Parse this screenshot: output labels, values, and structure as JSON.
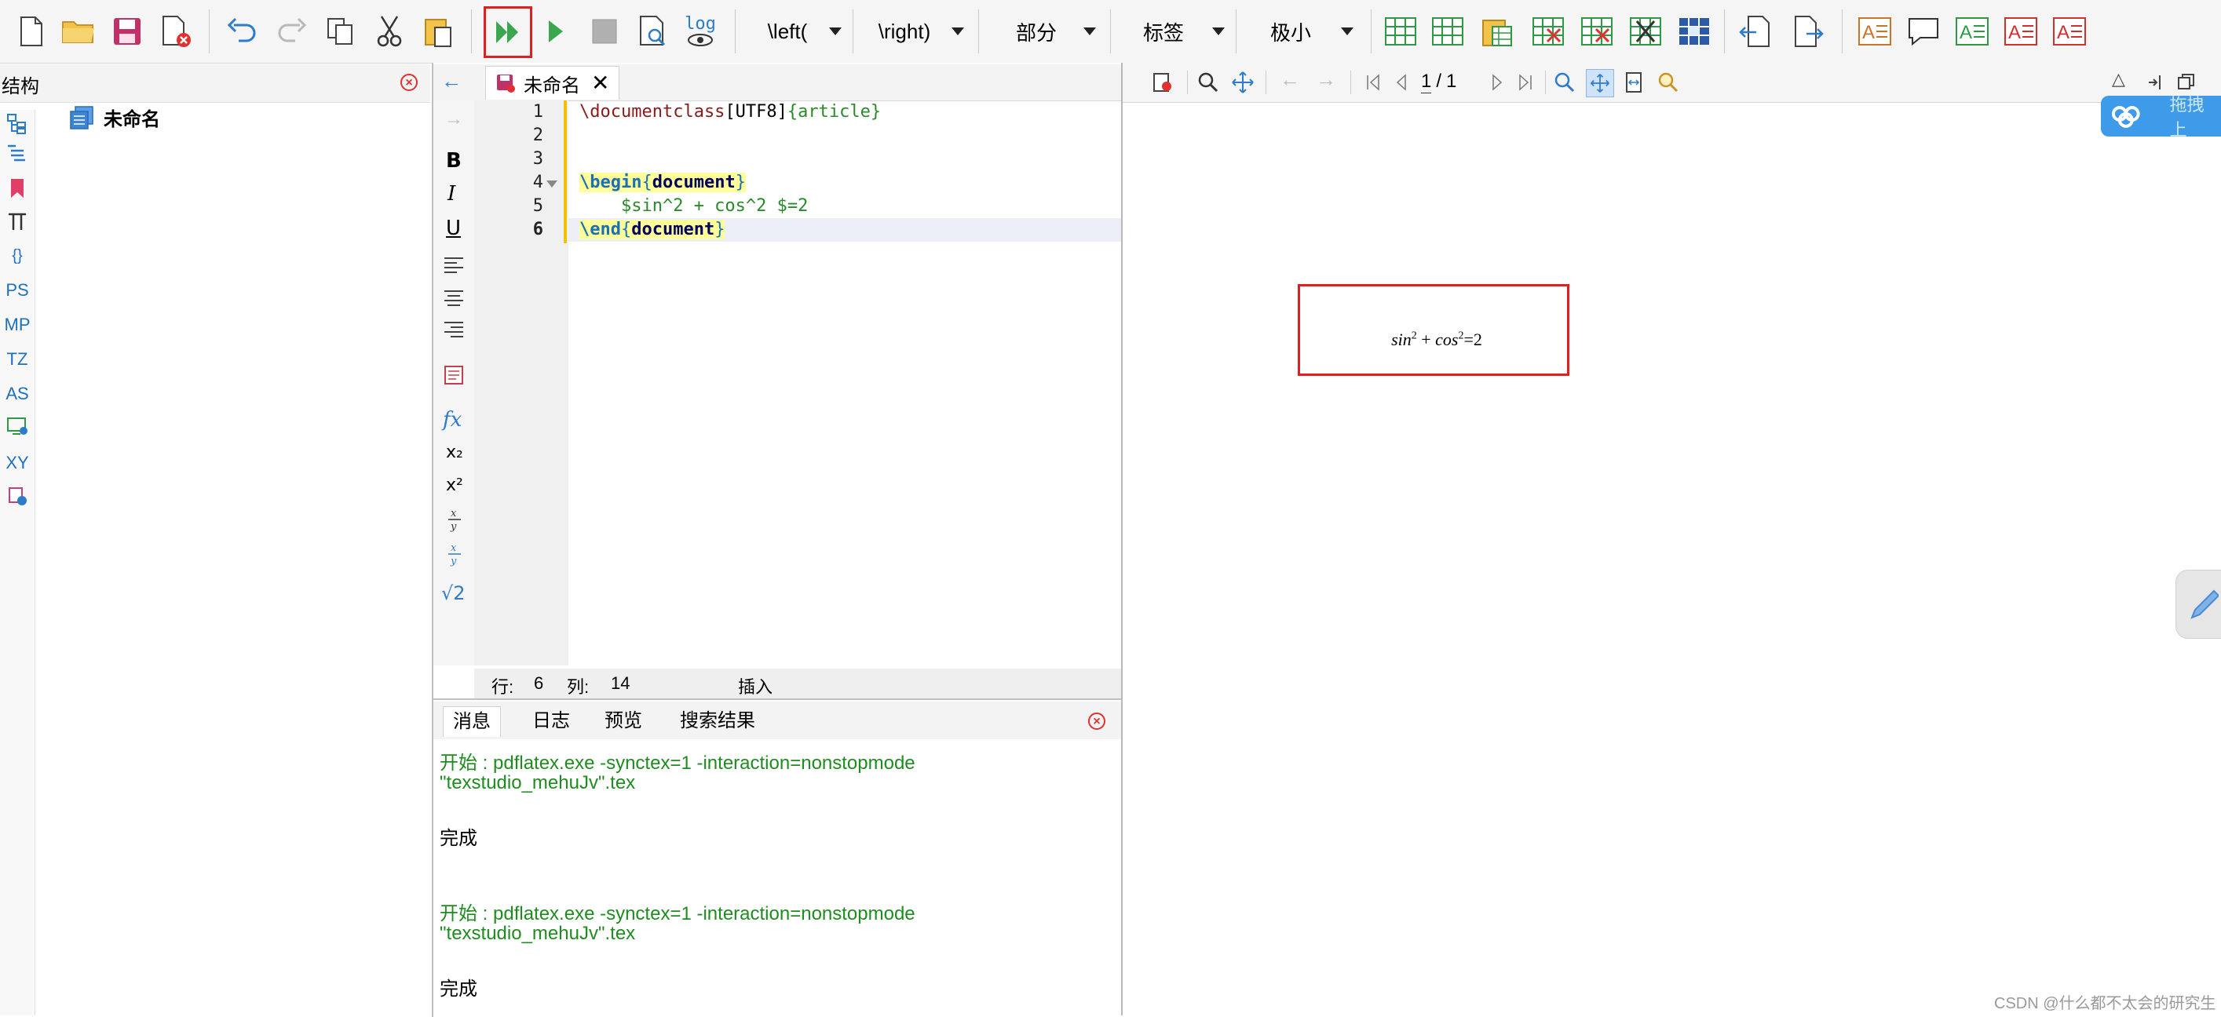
{
  "toolbar": {
    "left_delim": "\\left(",
    "right_delim": "\\right)",
    "section_combo": "部分",
    "label_combo": "标签",
    "size_combo": "极小",
    "log_label": "log"
  },
  "structure": {
    "title": "结构",
    "root_item": "未命名",
    "side_labels": [
      "PS",
      "MP",
      "TZ",
      "AS",
      "XY"
    ]
  },
  "editor": {
    "tab_title": "未命名",
    "line_numbers": [
      "1",
      "2",
      "3",
      "4",
      "5",
      "6"
    ],
    "lines": {
      "l1_cmd": "\\documentclass",
      "l1_opt": "[UTF8]",
      "l1_arg": "{article}",
      "l4_cmd": "\\begin",
      "l4_env": "document",
      "l5_code": "    $sin^2 + cos^2 $=2",
      "l6_cmd": "\\end",
      "l6_env": "document"
    },
    "format_labels": {
      "bold": "B",
      "italic": "I",
      "underline": "U",
      "fx": "fx",
      "sub": "x₂",
      "sup": "x²",
      "sqrt": "√2"
    }
  },
  "status": {
    "row_label": "行:",
    "row_value": "6",
    "col_label": "列:",
    "col_value": "14",
    "mode": "插入"
  },
  "messages": {
    "tabs": [
      "消息",
      "日志",
      "预览",
      "搜索结果"
    ],
    "active_tab": "消息",
    "entries": [
      {
        "line1": "开始 : pdflatex.exe -synctex=1 -interaction=nonstopmode",
        "line2": "\"texstudio_mehuJv\".tex",
        "done": "完成"
      },
      {
        "line1": "开始 : pdflatex.exe -synctex=1 -interaction=nonstopmode",
        "line2": "\"texstudio_mehuJv\".tex",
        "done": "完成"
      }
    ]
  },
  "pdf": {
    "page_current": "1",
    "page_total": "1",
    "cloud_label": "拖拽上"
  },
  "watermark": "CSDN @什么都不太会的研究生"
}
